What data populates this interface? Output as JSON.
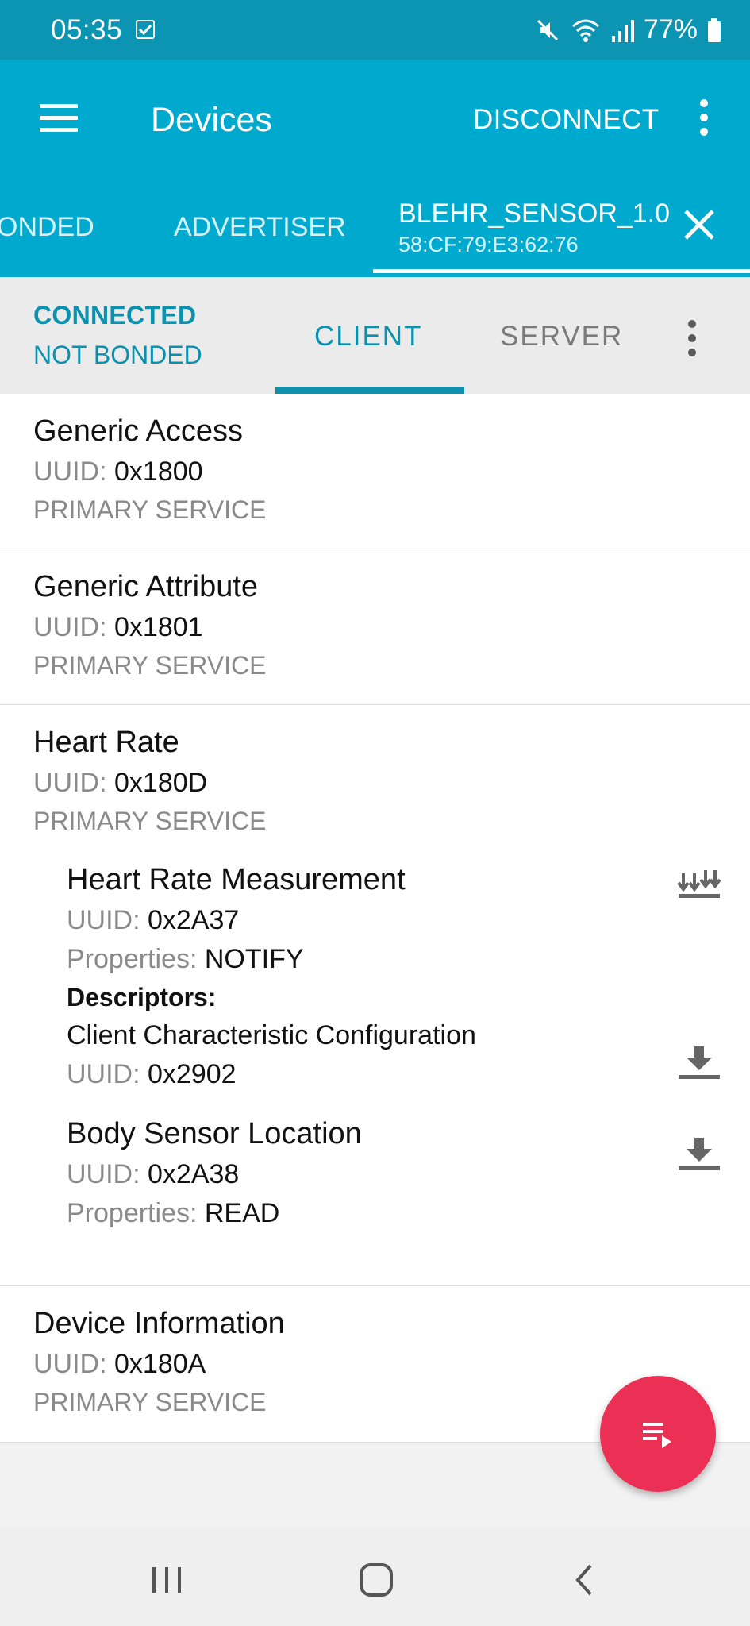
{
  "status_bar": {
    "time": "05:35",
    "battery": "77%",
    "icons": [
      "checkbox-notification-icon",
      "mute-icon",
      "wifi-icon",
      "signal-icon",
      "battery-icon"
    ]
  },
  "app_bar": {
    "title": "Devices",
    "disconnect_label": "DISCONNECT",
    "tabs": {
      "bonded": "ONDED",
      "advertiser": "ADVERTISER",
      "device_name": "BLEHR_SENSOR_1.0",
      "device_mac": "58:CF:79:E3:62:76"
    },
    "color": "#00a9ce"
  },
  "sub_bar": {
    "connection": "CONNECTED",
    "bond": "NOT BONDED",
    "tab_client": "CLIENT",
    "tab_server": "SERVER",
    "accent": "#0b90ad"
  },
  "uuid_label": "UUID:",
  "properties_label": "Properties:",
  "services": [
    {
      "name": "Generic Access",
      "uuid": "0x1800",
      "type": "PRIMARY SERVICE"
    },
    {
      "name": "Generic Attribute",
      "uuid": "0x1801",
      "type": "PRIMARY SERVICE"
    },
    {
      "name": "Heart Rate",
      "uuid": "0x180D",
      "type": "PRIMARY SERVICE",
      "characteristics": [
        {
          "name": "Heart Rate Measurement",
          "uuid": "0x2A37",
          "properties": "NOTIFY",
          "descriptors_label": "Descriptors:",
          "descriptor": {
            "name": "Client Characteristic Configuration",
            "uuid": "0x2902"
          }
        },
        {
          "name": "Body Sensor Location",
          "uuid": "0x2A38",
          "properties": "READ"
        }
      ]
    },
    {
      "name": "Device Information",
      "uuid": "0x180A",
      "type": "PRIMARY SERVICE"
    }
  ],
  "fab": {
    "color": "#ec2f54",
    "icon": "log-playlist-icon"
  }
}
